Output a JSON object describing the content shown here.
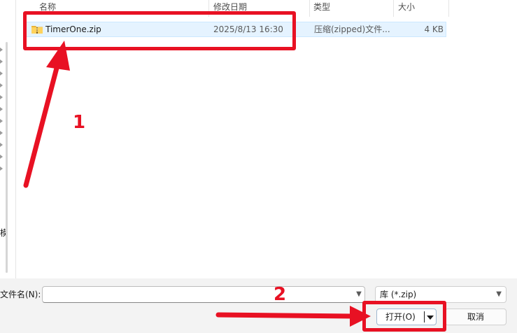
{
  "columns": {
    "name": "名称",
    "modified": "修改日期",
    "type": "类型",
    "size": "大小"
  },
  "files": [
    {
      "name": "TimerOne.zip",
      "modified": "2025/8/13 16:30",
      "type": "压缩(zipped)文件...",
      "size": "4 KB",
      "icon": "zip-folder-icon",
      "selected": true
    }
  ],
  "nav": {
    "partial_label": "模"
  },
  "bottom": {
    "filename_label": "文件名(N):",
    "filename_value": "",
    "filetype_value": "库 (*.zip)",
    "open_label": "打开(O)",
    "cancel_label": "取消"
  },
  "annotations": {
    "step1": "1",
    "step2": "2",
    "color": "#e81123"
  },
  "colors": {
    "selection_bg": "#e5f3ff",
    "selection_border": "#cce8ff",
    "bottom_bar_bg": "#f3f3f3"
  }
}
